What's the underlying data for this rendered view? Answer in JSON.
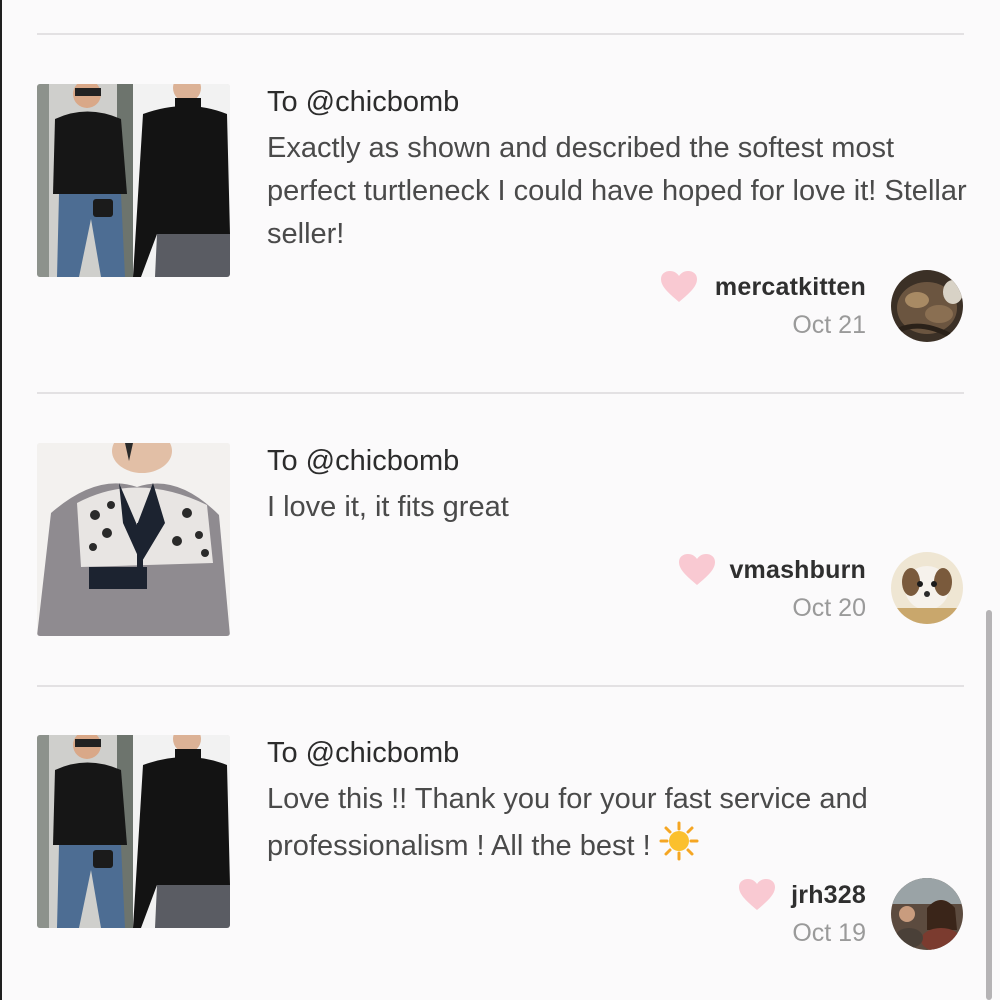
{
  "reviews": [
    {
      "to": "To @chicbomb",
      "text": "Exactly as shown and described the softest most perfect turtleneck I could have hoped for love it! Stellar seller!",
      "reviewer": "mercatkitten",
      "date": "Oct 21",
      "product_image": "black-turtleneck-photo",
      "avatar_image": "cat-avatar"
    },
    {
      "to": "To @chicbomb",
      "text": "I love it, it fits great",
      "reviewer": "vmashburn",
      "date": "Oct 20",
      "product_image": "leopard-fleece-pullover-photo",
      "avatar_image": "dog-avatar"
    },
    {
      "to": "To @chicbomb",
      "text": "Love this !! Thank you for your fast service and professionalism ! All the best !",
      "reviewer": "jrh328",
      "date": "Oct 19",
      "product_image": "black-turtleneck-photo",
      "avatar_image": "person-avatar",
      "emoji": "sun-icon"
    }
  ],
  "colors": {
    "background": "#fbfafb",
    "divider": "#e3e1e3",
    "heart": "#f9c9d2",
    "date_gray": "#9a9a9a"
  }
}
